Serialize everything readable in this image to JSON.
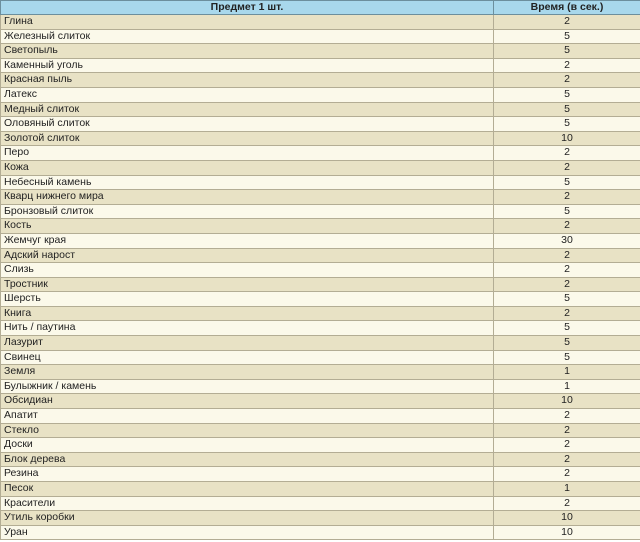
{
  "table": {
    "headers": {
      "item": "Предмет 1 шт.",
      "time": "Время (в сек.)"
    },
    "rows": [
      {
        "item": "Глина",
        "time": "2"
      },
      {
        "item": "Железный слиток",
        "time": "5"
      },
      {
        "item": "Светопыль",
        "time": "5"
      },
      {
        "item": "Каменный уголь",
        "time": "2"
      },
      {
        "item": "Красная пыль",
        "time": "2"
      },
      {
        "item": "Латекс",
        "time": "5"
      },
      {
        "item": "Медный слиток",
        "time": "5"
      },
      {
        "item": "Оловяный слиток",
        "time": "5"
      },
      {
        "item": "Золотой слиток",
        "time": "10"
      },
      {
        "item": "Перо",
        "time": "2"
      },
      {
        "item": "Кожа",
        "time": "2"
      },
      {
        "item": "Небесный камень",
        "time": "5"
      },
      {
        "item": "Кварц нижнего мира",
        "time": "2"
      },
      {
        "item": "Бронзовый слиток",
        "time": "5"
      },
      {
        "item": "Кость",
        "time": "2"
      },
      {
        "item": "Жемчуг края",
        "time": "30"
      },
      {
        "item": "Адский нарост",
        "time": "2"
      },
      {
        "item": "Слизь",
        "time": "2"
      },
      {
        "item": "Тростник",
        "time": "2"
      },
      {
        "item": "Шерсть",
        "time": "5"
      },
      {
        "item": "Книга",
        "time": "2"
      },
      {
        "item": "Нить / паутина",
        "time": "5"
      },
      {
        "item": "Лазурит",
        "time": "5"
      },
      {
        "item": "Свинец",
        "time": "5"
      },
      {
        "item": "Земля",
        "time": "1"
      },
      {
        "item": "Булыжник / камень",
        "time": "1"
      },
      {
        "item": "Обсидиан",
        "time": "10"
      },
      {
        "item": "Апатит",
        "time": "2"
      },
      {
        "item": "Стекло",
        "time": "2"
      },
      {
        "item": "Доски",
        "time": "2"
      },
      {
        "item": "Блок дерева",
        "time": "2"
      },
      {
        "item": "Резина",
        "time": "2"
      },
      {
        "item": "Песок",
        "time": "1"
      },
      {
        "item": "Красители",
        "time": "2"
      },
      {
        "item": "Утиль коробки",
        "time": "10"
      },
      {
        "item": "Уран",
        "time": "10"
      }
    ]
  }
}
